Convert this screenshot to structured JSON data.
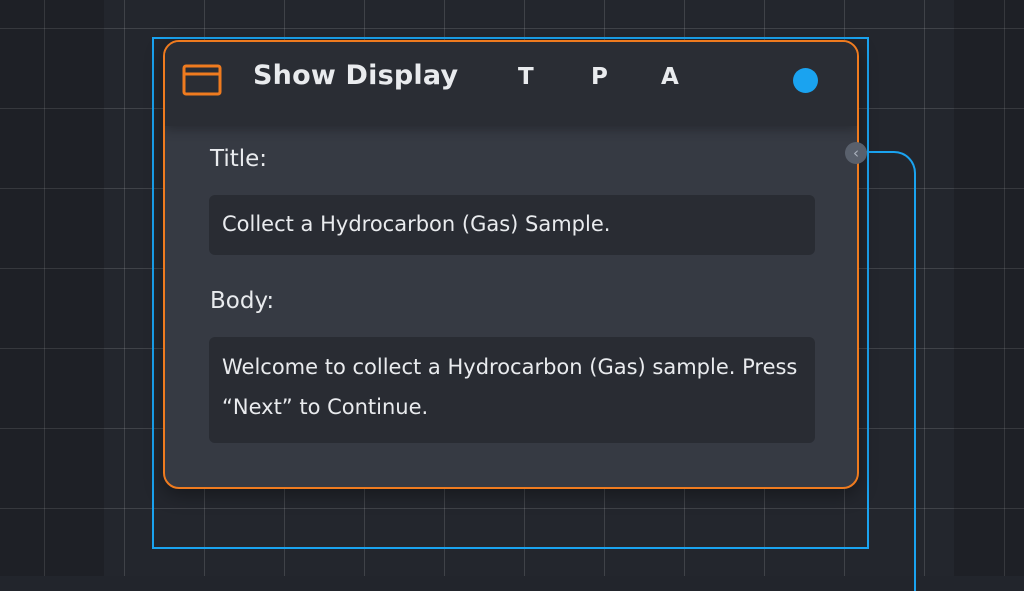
{
  "node": {
    "title": "Show Display",
    "icon": "window-icon",
    "flags": [
      "T",
      "P",
      "A"
    ],
    "status_color": "#1aa3f0",
    "accent_color": "#ef7b1f"
  },
  "fields": {
    "title_label": "Title:",
    "title_value": "Collect a Hydrocarbon (Gas) Sample.",
    "body_label": "Body:",
    "body_value": "Welcome to collect a Hydrocarbon (Gas) sample. Press “Next” to Continue."
  },
  "connection": {
    "port_icon": "chevron-left-icon",
    "port_glyph": "‹",
    "line_color": "#1aa3f0"
  }
}
